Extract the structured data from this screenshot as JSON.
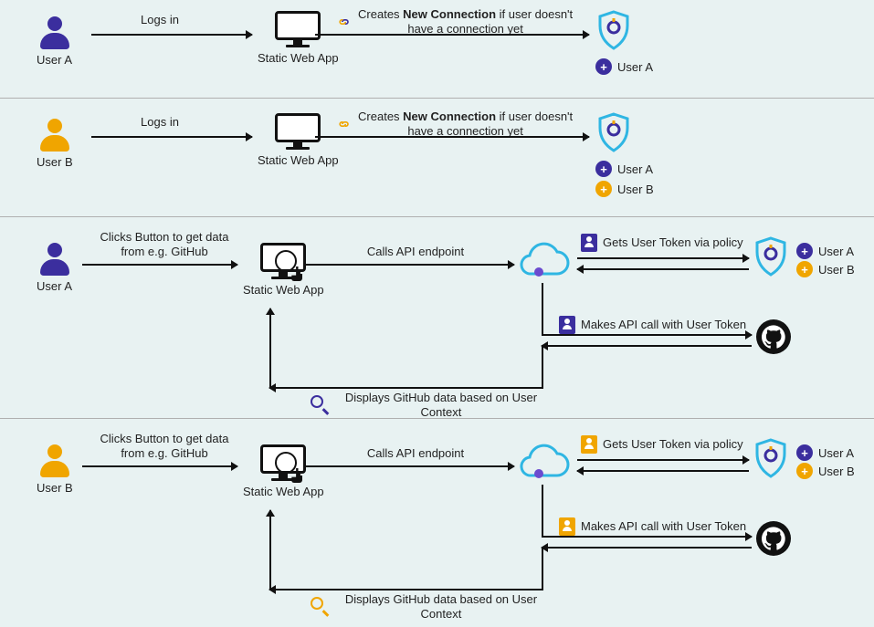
{
  "labels": {
    "user_a": "User A",
    "user_b": "User B",
    "swa": "Static Web App"
  },
  "actions": {
    "logs_in": "Logs in",
    "new_conn_pre": "Creates ",
    "new_conn_bold": "New Connection",
    "new_conn_post": " if user doesn't have a connection yet",
    "click_button": "Clicks Button to get data from e.g. GitHub",
    "calls_api": "Calls API endpoint",
    "gets_token": "Gets User Token via policy",
    "makes_call": "Makes API call with User Token",
    "displays": "Displays GitHub data based on User Context"
  },
  "colors": {
    "user_a": "#3b2e9e",
    "user_b": "#f0a500",
    "cloud_stroke": "#2fb6e3",
    "shield_stroke": "#2fb6e3"
  }
}
